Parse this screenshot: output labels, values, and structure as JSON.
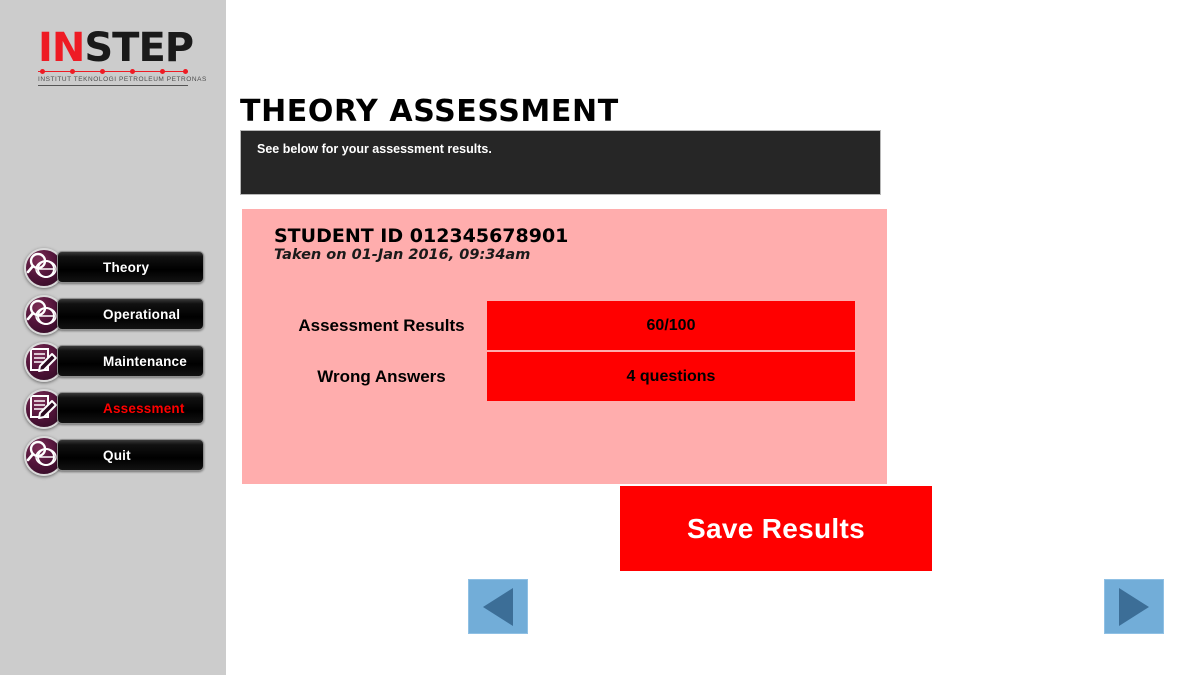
{
  "brand": {
    "logo_part1": "IN",
    "logo_part2": "STEP",
    "tagline": "INSTITUT TEKNOLOGI PETROLEUM PETRONAS",
    "accent_red": "#ee1b24"
  },
  "sidebar": {
    "items": [
      {
        "label": "Theory",
        "icon": "magnifier-globe-icon",
        "active": false
      },
      {
        "label": "Operational",
        "icon": "magnifier-globe-icon",
        "active": false
      },
      {
        "label": "Maintenance",
        "icon": "document-pencil-icon",
        "active": false
      },
      {
        "label": "Assessment",
        "icon": "document-pencil-icon",
        "active": true
      },
      {
        "label": "Quit",
        "icon": "magnifier-globe-icon",
        "active": false
      }
    ],
    "active_label_color": "#ff0000",
    "label_color": "#ffffff"
  },
  "main": {
    "title": "THEORY ASSESSMENT",
    "banner_text": "See below for your assessment results.",
    "banner_bg": "#262626",
    "panel_bg": "#ffadad",
    "student_id_line": "STUDENT ID 012345678901",
    "taken_on_line": "Taken on 01-Jan 2016, 09:34am",
    "results": [
      {
        "label": "Assessment Results",
        "value": "60/100"
      },
      {
        "label": "Wrong Answers",
        "value": "4 questions"
      }
    ],
    "value_bg": "#ff0000",
    "save_label": "Save Results",
    "save_bg": "#ff0000",
    "nav": {
      "prev_icon": "triangle-left-icon",
      "next_icon": "triangle-right-icon",
      "bg": "#72add8",
      "glyph": "#3c6e97"
    }
  }
}
